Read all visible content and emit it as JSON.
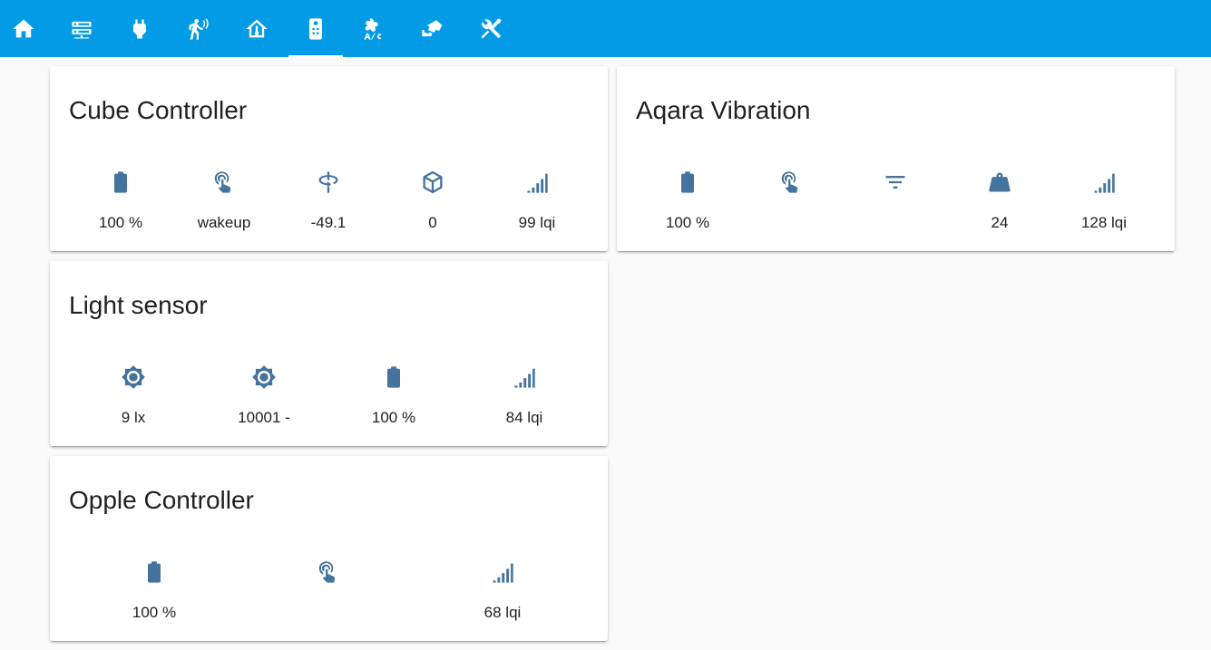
{
  "header": {
    "tabs": [
      {
        "icon": "home-icon"
      },
      {
        "icon": "server-network-icon"
      },
      {
        "icon": "power-plug-icon"
      },
      {
        "icon": "motion-sensor-icon"
      },
      {
        "icon": "home-thermometer-icon"
      },
      {
        "icon": "remote-icon",
        "active": true
      },
      {
        "icon": "air-conditioner-icon"
      },
      {
        "icon": "cctv-icon"
      },
      {
        "icon": "tools-icon"
      }
    ],
    "accent_color": "#039be5"
  },
  "icon_color": "#44739e",
  "cards": {
    "cube": {
      "title": "Cube Controller",
      "badges": [
        {
          "icon": "battery-icon",
          "value": "100 %"
        },
        {
          "icon": "gesture-tap-icon",
          "value": "wakeup"
        },
        {
          "icon": "rotate-3d-icon",
          "value": "-49.1"
        },
        {
          "icon": "cube-outline-icon",
          "value": "0"
        },
        {
          "icon": "signal-icon",
          "value": "99 lqi"
        }
      ]
    },
    "aqara": {
      "title": "Aqara Vibration",
      "badges": [
        {
          "icon": "battery-icon",
          "value": "100 %"
        },
        {
          "icon": "gesture-tap-icon",
          "value": ""
        },
        {
          "icon": "filter-variant-icon",
          "value": ""
        },
        {
          "icon": "weight-icon",
          "value": "24"
        },
        {
          "icon": "signal-icon",
          "value": "128 lqi"
        }
      ]
    },
    "light": {
      "title": "Light sensor",
      "badges": [
        {
          "icon": "brightness-icon",
          "value": "9 lx"
        },
        {
          "icon": "brightness-icon",
          "value": "10001 -"
        },
        {
          "icon": "battery-icon",
          "value": "100 %"
        },
        {
          "icon": "signal-icon",
          "value": "84 lqi"
        }
      ]
    },
    "opple": {
      "title": "Opple Controller",
      "badges": [
        {
          "icon": "battery-icon",
          "value": "100 %"
        },
        {
          "icon": "gesture-tap-icon",
          "value": ""
        },
        {
          "icon": "signal-icon",
          "value": "68 lqi"
        }
      ]
    }
  }
}
